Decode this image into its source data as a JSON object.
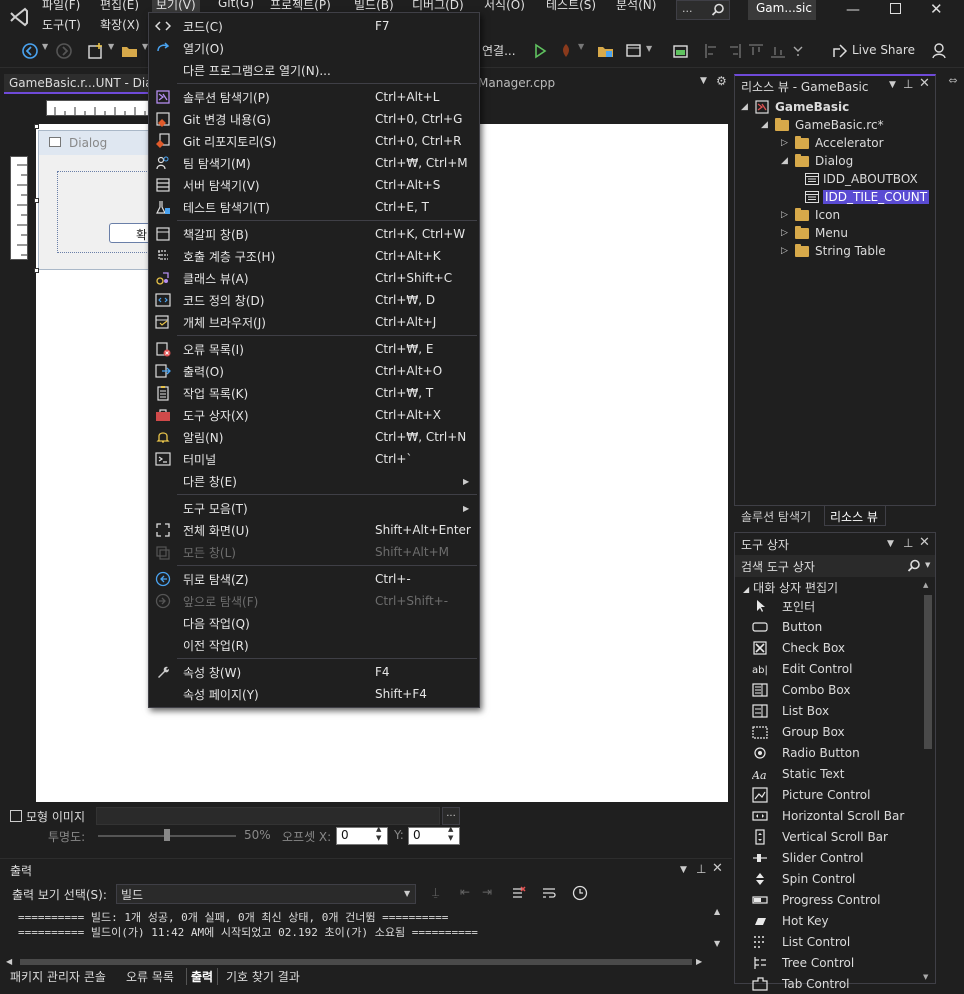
{
  "menubar": {
    "items": [
      "파일(F)",
      "편집(E)",
      "보기(V)",
      "Git(G)",
      "프로젝트(P)",
      "빌드(B)",
      "디버그(D)",
      "서식(O)",
      "테스트(S)",
      "분석(N)"
    ],
    "row2": [
      "도구(T)",
      "확장(X)"
    ],
    "search_label": "...",
    "window_title": "Gam...sic"
  },
  "toolbar": {
    "connect_label": "연결...",
    "live_share": "Live Share"
  },
  "doc_tab": {
    "left": "GameBasic.r...UNT - Dia",
    "right": "Manager.cpp"
  },
  "dialog_preview": {
    "title": "Dialog",
    "button": "확"
  },
  "view_menu": {
    "items": [
      {
        "label": "코드(C)",
        "shortcut": "F7",
        "icon": "code-icon",
        "group": 0
      },
      {
        "label": "열기(O)",
        "shortcut": "",
        "icon": "open-icon",
        "group": 0
      },
      {
        "label": "다른 프로그램으로 열기(N)...",
        "shortcut": "",
        "icon": "",
        "group": 0
      },
      {
        "label": "솔루션 탐색기(P)",
        "shortcut": "Ctrl+Alt+L",
        "icon": "solution-explorer-icon",
        "group": 1
      },
      {
        "label": "Git 변경 내용(G)",
        "shortcut": "Ctrl+0, Ctrl+G",
        "icon": "git-changes-icon",
        "group": 1
      },
      {
        "label": "Git 리포지토리(S)",
        "shortcut": "Ctrl+0, Ctrl+R",
        "icon": "git-repo-icon",
        "group": 1
      },
      {
        "label": "팀 탐색기(M)",
        "shortcut": "Ctrl+₩, Ctrl+M",
        "icon": "team-explorer-icon",
        "group": 1
      },
      {
        "label": "서버 탐색기(V)",
        "shortcut": "Ctrl+Alt+S",
        "icon": "server-explorer-icon",
        "group": 1
      },
      {
        "label": "테스트 탐색기(T)",
        "shortcut": "Ctrl+E, T",
        "icon": "test-explorer-icon",
        "group": 1
      },
      {
        "label": "책갈피 창(B)",
        "shortcut": "Ctrl+K, Ctrl+W",
        "icon": "bookmark-icon",
        "group": 2
      },
      {
        "label": "호출 계층 구조(H)",
        "shortcut": "Ctrl+Alt+K",
        "icon": "call-hierarchy-icon",
        "group": 2
      },
      {
        "label": "클래스 뷰(A)",
        "shortcut": "Ctrl+Shift+C",
        "icon": "class-view-icon",
        "group": 2
      },
      {
        "label": "코드 정의 창(D)",
        "shortcut": "Ctrl+₩, D",
        "icon": "code-definition-icon",
        "group": 2
      },
      {
        "label": "개체 브라우저(J)",
        "shortcut": "Ctrl+Alt+J",
        "icon": "object-browser-icon",
        "group": 2
      },
      {
        "label": "오류 목록(I)",
        "shortcut": "Ctrl+₩, E",
        "icon": "error-list-icon",
        "group": 3
      },
      {
        "label": "출력(O)",
        "shortcut": "Ctrl+Alt+O",
        "icon": "output-icon",
        "group": 3
      },
      {
        "label": "작업 목록(K)",
        "shortcut": "Ctrl+₩, T",
        "icon": "task-list-icon",
        "group": 3
      },
      {
        "label": "도구 상자(X)",
        "shortcut": "Ctrl+Alt+X",
        "icon": "toolbox-icon",
        "group": 3
      },
      {
        "label": "알림(N)",
        "shortcut": "Ctrl+₩, Ctrl+N",
        "icon": "bell-icon",
        "group": 3
      },
      {
        "label": "터미널",
        "shortcut": "Ctrl+`",
        "icon": "terminal-icon",
        "group": 3
      },
      {
        "label": "다른 창(E)",
        "shortcut": "",
        "icon": "",
        "group": 3,
        "submenu": true
      },
      {
        "label": "도구 모음(T)",
        "shortcut": "",
        "icon": "",
        "group": 4,
        "submenu": true
      },
      {
        "label": "전체 화면(U)",
        "shortcut": "Shift+Alt+Enter",
        "icon": "fullscreen-icon",
        "group": 4
      },
      {
        "label": "모든 창(L)",
        "shortcut": "Shift+Alt+M",
        "icon": "all-windows-icon",
        "group": 4,
        "disabled": true
      },
      {
        "label": "뒤로 탐색(Z)",
        "shortcut": "Ctrl+-",
        "icon": "back-icon",
        "group": 5
      },
      {
        "label": "앞으로 탐색(F)",
        "shortcut": "Ctrl+Shift+-",
        "icon": "forward-icon",
        "group": 5,
        "disabled": true
      },
      {
        "label": "다음 작업(Q)",
        "shortcut": "",
        "icon": "",
        "group": 5
      },
      {
        "label": "이전 작업(R)",
        "shortcut": "",
        "icon": "",
        "group": 5
      },
      {
        "label": "속성 창(W)",
        "shortcut": "F4",
        "icon": "wrench-icon",
        "group": 6
      },
      {
        "label": "속성 페이지(Y)",
        "shortcut": "Shift+F4",
        "icon": "",
        "group": 6
      }
    ]
  },
  "resource_view": {
    "title": "리소스 뷰 - GameBasic",
    "tree": [
      {
        "label": "GameBasic",
        "level": 0,
        "kind": "project",
        "expanded": true
      },
      {
        "label": "GameBasic.rc*",
        "level": 1,
        "kind": "folder",
        "expanded": true
      },
      {
        "label": "Accelerator",
        "level": 2,
        "kind": "folder",
        "expanded": false
      },
      {
        "label": "Dialog",
        "level": 2,
        "kind": "folder",
        "expanded": true
      },
      {
        "label": "IDD_ABOUTBOX",
        "level": 3,
        "kind": "dialog"
      },
      {
        "label": "IDD_TILE_COUNT",
        "level": 3,
        "kind": "dialog",
        "selected": true
      },
      {
        "label": "Icon",
        "level": 2,
        "kind": "folder",
        "expanded": false
      },
      {
        "label": "Menu",
        "level": 2,
        "kind": "folder",
        "expanded": false
      },
      {
        "label": "String Table",
        "level": 2,
        "kind": "folder",
        "expanded": false
      }
    ],
    "tabs": [
      "솔루션 탐색기",
      "리소스 뷰"
    ]
  },
  "toolbox": {
    "title": "도구 상자",
    "search_placeholder": "검색 도구 상자",
    "group": "대화 상자 편집기",
    "items": [
      {
        "label": "포인터",
        "icon": "pointer-icon"
      },
      {
        "label": "Button",
        "icon": "button-icon"
      },
      {
        "label": "Check Box",
        "icon": "checkbox-icon"
      },
      {
        "label": "Edit Control",
        "icon": "edit-control-icon"
      },
      {
        "label": "Combo Box",
        "icon": "combo-box-icon"
      },
      {
        "label": "List Box",
        "icon": "list-box-icon"
      },
      {
        "label": "Group Box",
        "icon": "group-box-icon"
      },
      {
        "label": "Radio Button",
        "icon": "radio-button-icon"
      },
      {
        "label": "Static Text",
        "icon": "static-text-icon"
      },
      {
        "label": "Picture Control",
        "icon": "picture-control-icon"
      },
      {
        "label": "Horizontal Scroll Bar",
        "icon": "hscroll-icon"
      },
      {
        "label": "Vertical Scroll Bar",
        "icon": "vscroll-icon"
      },
      {
        "label": "Slider Control",
        "icon": "slider-icon"
      },
      {
        "label": "Spin Control",
        "icon": "spin-icon"
      },
      {
        "label": "Progress Control",
        "icon": "progress-icon"
      },
      {
        "label": "Hot Key",
        "icon": "hotkey-icon"
      },
      {
        "label": "List Control",
        "icon": "list-control-icon"
      },
      {
        "label": "Tree Control",
        "icon": "tree-control-icon"
      },
      {
        "label": "Tab Control",
        "icon": "tab-control-icon"
      }
    ]
  },
  "guide_bar": {
    "mock_image": "모형 이미지",
    "browse": "...",
    "transparency_label": "투명도:",
    "transparency_value": "50%",
    "offset_x_label": "오프셋 X:",
    "offset_x": "0",
    "offset_y_label": "Y:",
    "offset_y": "0"
  },
  "output": {
    "title": "출력",
    "source_label": "출력 보기 선택(S):",
    "source_value": "빌드",
    "lines": [
      "========== 빌드: 1개 성공, 0개 실패, 0개 최신 상태, 0개 건너뜀 ==========",
      "========== 빌드이(가) 11:42 AM에 시작되었고 02.192 초이(가) 소요됨 =========="
    ]
  },
  "bottom_tabs": [
    "패키지 관리자 콘솔",
    "오류 목록",
    "출력",
    "기호 찾기 결과"
  ],
  "colors": {
    "accent": "#6f4ad8",
    "selection": "#5a4bd3",
    "menu_bg": "#1f1f1f",
    "folder": "#d7a94a"
  }
}
